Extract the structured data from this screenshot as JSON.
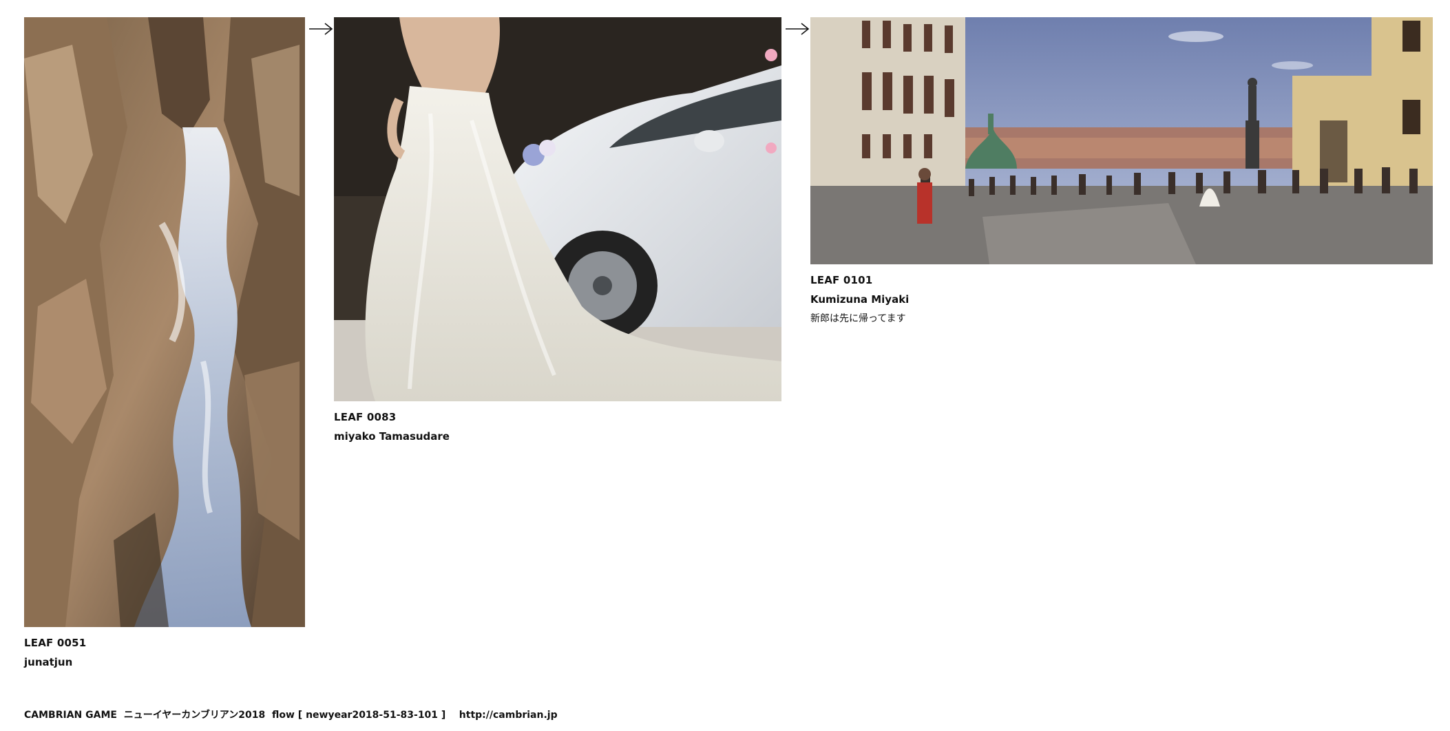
{
  "leaves": [
    {
      "id": "LEAF 0051",
      "author": "junatjun",
      "comment": "",
      "image_subject": "waterfall"
    },
    {
      "id": "LEAF 0083",
      "author": "miyako Tamasudare",
      "comment": "",
      "image_subject": "bride-and-car"
    },
    {
      "id": "LEAF 0101",
      "author": "Kumizuna Miyaki",
      "comment": "新郎は先に帰ってます",
      "image_subject": "castle-square"
    }
  ],
  "arrow_icon": "right-arrow-icon",
  "footer": {
    "text": "CAMBRIAN GAME  ニューイヤーカンブリアン2018  flow [ newyear2018-51-83-101 ]    http://cambrian.jp"
  }
}
